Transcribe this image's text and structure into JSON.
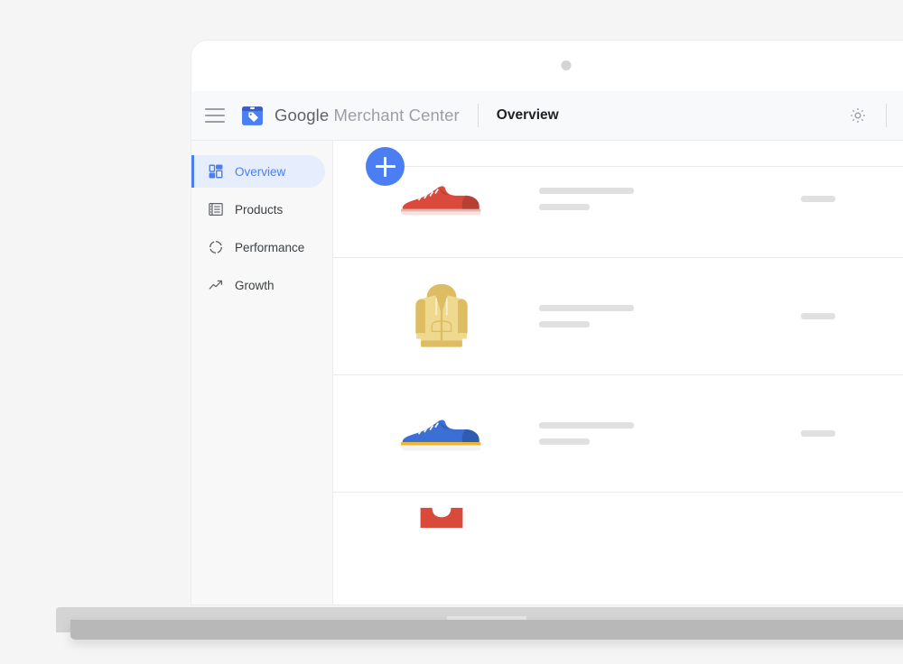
{
  "device": {
    "type": "laptop-mockup",
    "camera_icon": "camera-dot-icon"
  },
  "topbar": {
    "menu_icon": "hamburger-menu-icon",
    "brand_icon": "merchant-center-logo-icon",
    "brand_google": "Google",
    "brand_product": " Merchant Center",
    "page_title": "Overview",
    "settings_icon": "gear-icon",
    "mail_icon": "mail-icon"
  },
  "sidebar": {
    "items": [
      {
        "label": "Overview",
        "icon": "dashboard-grid-icon",
        "active": true
      },
      {
        "label": "Products",
        "icon": "list-icon",
        "active": false
      },
      {
        "label": "Performance",
        "icon": "donut-chart-icon",
        "active": false
      },
      {
        "label": "Growth",
        "icon": "trending-up-icon",
        "active": false
      }
    ]
  },
  "content": {
    "add_button": {
      "label": "+",
      "name": "add-product-button"
    },
    "products": [
      {
        "image": "red-sneaker-illustration",
        "title_placeholder": "",
        "subtitle_placeholder": "",
        "price_placeholder": ""
      },
      {
        "image": "yellow-hoodie-illustration",
        "title_placeholder": "",
        "subtitle_placeholder": "",
        "price_placeholder": ""
      },
      {
        "image": "blue-sneaker-illustration",
        "title_placeholder": "",
        "subtitle_placeholder": "",
        "price_placeholder": ""
      },
      {
        "image": "red-bag-illustration",
        "title_placeholder": "",
        "subtitle_placeholder": "",
        "price_placeholder": ""
      }
    ]
  },
  "colors": {
    "accent_blue": "#4c7ef3",
    "accent_blue_light": "#e6edfd",
    "page_bg": "#f5f5f5",
    "topbar_bg": "#f8f9fa",
    "sidebar_bg": "#f8f8f8",
    "placeholder_gray": "#e0e0e0",
    "red_shoe": "#d9493c",
    "yellow_hoodie": "#e8cd7a",
    "blue_shoe": "#3b6fd4",
    "laptop_base": "#d4d4d4"
  }
}
